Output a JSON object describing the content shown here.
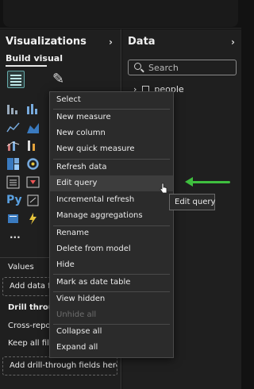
{
  "visualizations": {
    "title": "Visualizations",
    "build_visual": "Build visual",
    "values_label": "Values",
    "add_data_fields": "Add data fi",
    "drill_through": "Drill throug",
    "cross_report": "Cross-repor",
    "keep_all_filters": "Keep all filte",
    "add_drill_fields": "Add drill-through fields here",
    "more": "..."
  },
  "data_pane": {
    "title": "Data",
    "search_placeholder": "Search",
    "tree_items": [
      {
        "label": "people"
      }
    ]
  },
  "context_menu": {
    "items": [
      {
        "label": "Select"
      },
      {
        "label": "New measure"
      },
      {
        "label": "New column"
      },
      {
        "label": "New quick measure"
      },
      {
        "label": "Refresh data"
      },
      {
        "label": "Edit query",
        "highlighted": true
      },
      {
        "label": "Incremental refresh"
      },
      {
        "label": "Manage aggregations"
      },
      {
        "label": "Rename"
      },
      {
        "label": "Delete from model"
      },
      {
        "label": "Hide"
      },
      {
        "label": "Mark as date table"
      },
      {
        "label": "View hidden"
      },
      {
        "label": "Unhide all",
        "disabled": true
      },
      {
        "label": "Collapse all"
      },
      {
        "label": "Expand all"
      }
    ]
  },
  "tooltip": {
    "text": "Edit query"
  },
  "colors": {
    "accent_arrow": "#3fbf3f",
    "pane_bg": "#1f1f1f",
    "menu_bg": "#2b2b2b",
    "highlight_bg": "#3d3d3d"
  }
}
